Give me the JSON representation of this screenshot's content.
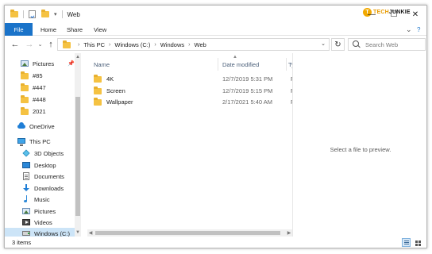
{
  "window": {
    "title": "Web",
    "logo": {
      "badge": "T",
      "text_a": "TECH",
      "text_b": "JUNKIE"
    },
    "controls": {
      "minimize": "—",
      "maximize": "☐",
      "close": "✕"
    }
  },
  "ribbon": {
    "tabs": [
      "File",
      "Home",
      "Share",
      "View"
    ],
    "expand_glyph": "⌄",
    "help_glyph": "?"
  },
  "address_bar": {
    "back_glyph": "←",
    "forward_glyph": "→",
    "recent_glyph": "⌄",
    "up_glyph": "↑",
    "breadcrumbs": [
      "This PC",
      "Windows (C:)",
      "Windows",
      "Web"
    ],
    "separator": "›",
    "dropdown_glyph": "⌄",
    "refresh_glyph": "↻",
    "search_placeholder": "Search Web"
  },
  "nav_pane": {
    "items": [
      {
        "label": "Pictures",
        "icon": "pictures-icon",
        "pinned": true
      },
      {
        "label": "#85",
        "icon": "folder-icon"
      },
      {
        "label": "#447",
        "icon": "folder-icon"
      },
      {
        "label": "#448",
        "icon": "folder-icon"
      },
      {
        "label": "2021",
        "icon": "folder-icon"
      },
      {
        "label": "OneDrive",
        "icon": "onedrive-icon"
      },
      {
        "label": "This PC",
        "icon": "this-pc-icon"
      },
      {
        "label": "3D Objects",
        "icon": "3d-objects-icon"
      },
      {
        "label": "Desktop",
        "icon": "desktop-icon"
      },
      {
        "label": "Documents",
        "icon": "documents-icon"
      },
      {
        "label": "Downloads",
        "icon": "downloads-icon"
      },
      {
        "label": "Music",
        "icon": "music-icon"
      },
      {
        "label": "Pictures",
        "icon": "pictures-icon"
      },
      {
        "label": "Videos",
        "icon": "videos-icon"
      },
      {
        "label": "Windows (C:)",
        "icon": "drive-icon",
        "selected": true
      }
    ]
  },
  "file_list": {
    "columns": {
      "name": "Name",
      "date": "Date modified",
      "type": "Ty"
    },
    "rows": [
      {
        "name": "4K",
        "date": "12/7/2019 5:31 PM",
        "type": "Fi"
      },
      {
        "name": "Screen",
        "date": "12/7/2019 5:15 PM",
        "type": "Fi"
      },
      {
        "name": "Wallpaper",
        "date": "2/17/2021 5:40 AM",
        "type": "Fi"
      }
    ]
  },
  "preview": {
    "message": "Select a file to preview."
  },
  "status_bar": {
    "item_count": "3 items"
  },
  "colors": {
    "accent": "#1a73c9",
    "folder": "#f5c242",
    "selection": "#cce4f7"
  }
}
